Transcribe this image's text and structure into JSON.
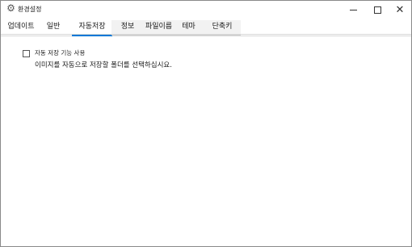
{
  "window": {
    "title": "환경설정",
    "app_icon": "gear-icon",
    "controls": {
      "minimize": "minimize-icon",
      "maximize": "maximize-icon",
      "close": "✕"
    }
  },
  "tabs": [
    {
      "label": "업데이트"
    },
    {
      "label": "일반"
    },
    {
      "label": "자동저장"
    },
    {
      "label": "정보"
    },
    {
      "label": "파일이름"
    },
    {
      "label": "테마"
    },
    {
      "label": "단축키"
    }
  ],
  "active_tab": "자동저장",
  "autosave": {
    "checkbox_label": "자동 저장 기능 사용",
    "checkbox_checked": false,
    "hint": "이미지를 자동으로 저장할 폴더를 선택하십시요."
  },
  "colors": {
    "accent": "#0078d7",
    "inactive_tab_bg": "#f2f2f2"
  }
}
